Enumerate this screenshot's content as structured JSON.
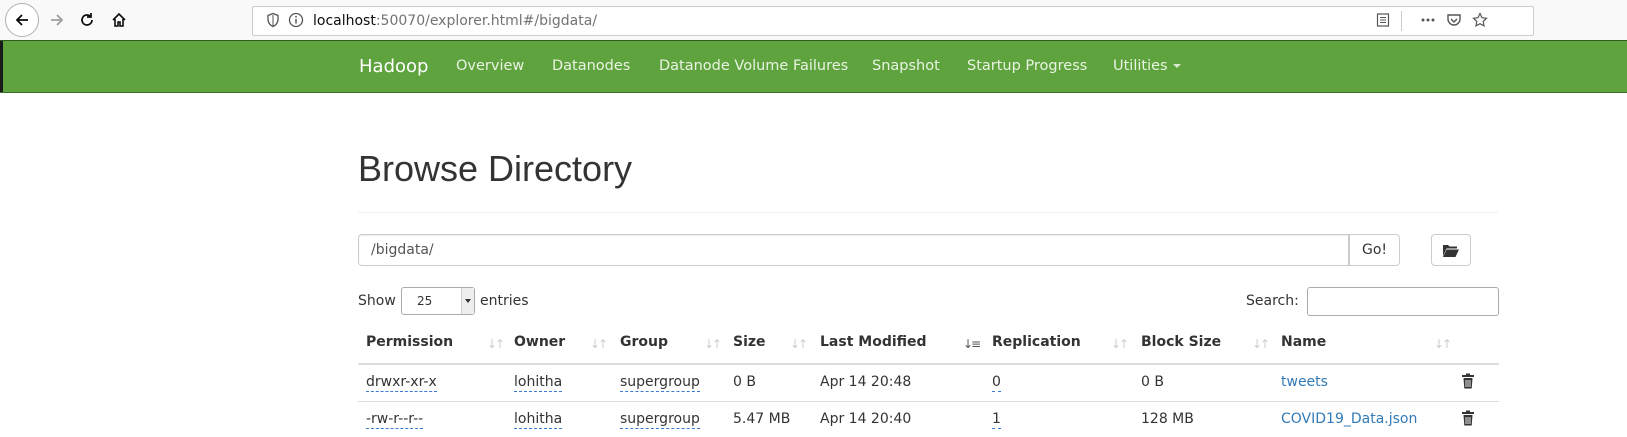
{
  "browser": {
    "url_host": "localhost",
    "url_rest": ":50070/explorer.html#/bigdata/"
  },
  "navbar": {
    "brand": "Hadoop",
    "items": [
      "Overview",
      "Datanodes",
      "Datanode Volume Failures",
      "Snapshot",
      "Startup Progress",
      "Utilities"
    ],
    "color": "#5fa33e"
  },
  "page": {
    "title": "Browse Directory",
    "path_value": "/bigdata/",
    "go_label": "Go!"
  },
  "table_controls": {
    "show_label": "Show",
    "entries_value": "25",
    "entries_label": "entries",
    "search_label": "Search:"
  },
  "table": {
    "columns": [
      "Permission",
      "Owner",
      "Group",
      "Size",
      "Last Modified",
      "Replication",
      "Block Size",
      "Name"
    ],
    "rows": [
      {
        "permission": "drwxr-xr-x",
        "owner": "lohitha",
        "group": "supergroup",
        "size": "0 B",
        "modified": "Apr 14 20:48",
        "replication": "0",
        "block_size": "0 B",
        "name": "tweets"
      },
      {
        "permission": "-rw-r--r--",
        "owner": "lohitha",
        "group": "supergroup",
        "size": "5.47 MB",
        "modified": "Apr 14 20:40",
        "replication": "1",
        "block_size": "128 MB",
        "name": "COVID19_Data.json"
      }
    ]
  }
}
